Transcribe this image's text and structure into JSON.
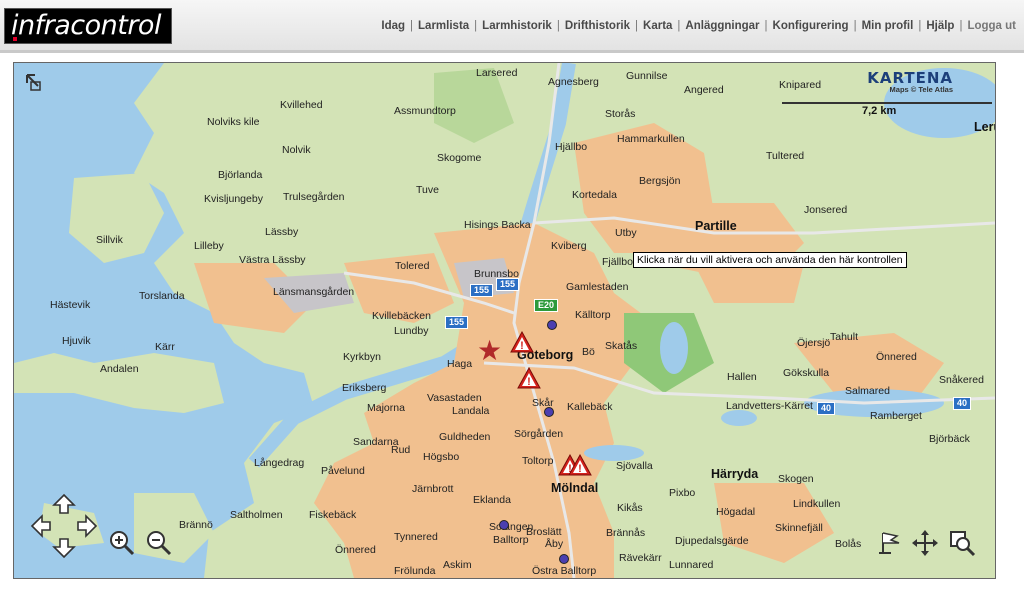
{
  "app": {
    "logo_text": "infracontrol"
  },
  "nav": {
    "items": [
      "Idag",
      "Larmlista",
      "Larmhistorik",
      "Drifthistorik",
      "Karta",
      "Anläggningar",
      "Konfigurering",
      "Min profil",
      "Hjälp"
    ],
    "logout": "Logga ut"
  },
  "map": {
    "provider": "KARTENA",
    "copyright": "Maps © Tele Atlas",
    "scale_label": "7,2 km",
    "tooltip": "Klicka när du vill aktivera och använda den här kontrollen",
    "places": [
      "Larsered",
      "Agnesberg",
      "Gunnilse",
      "Angered",
      "Knipared",
      "Kvillehed",
      "Assmundtorp",
      "Storås",
      "Nolviks kile",
      "Hjällbo",
      "Hammarkullen",
      "Tultered",
      "Lerum",
      "Nolvik",
      "Skogome",
      "Björlanda",
      "Bergsjön",
      "Kvisljungeby",
      "Trulsegården",
      "Tuve",
      "Kortedala",
      "Jonsered",
      "Partille",
      "Sillvik",
      "Lilleby",
      "Lässby",
      "Hisings Backa",
      "Kviberg",
      "Utby",
      "Västra Lässby",
      "Tolered",
      "Fjällbo",
      "Brunnsbo",
      "Gamlestaden",
      "Hästevik",
      "Torslanda",
      "Länsmansgården",
      "Kvillebäcken",
      "Lundby",
      "Källtorp",
      "Hjuvik",
      "Kärr",
      "Bö",
      "Skatås",
      "Tahult",
      "Kyrkbyn",
      "Haga",
      "Göteborg",
      "Öjersjö",
      "Önnered",
      "Andalen",
      "Hallen",
      "Gökskulla",
      "Salmared",
      "Snåkered",
      "Eriksberg",
      "Vasastaden",
      "Landala",
      "Skår",
      "Kallebäck",
      "Majorna",
      "Landvetters-Kärret",
      "Ramberget",
      "Sandarna",
      "Guldheden",
      "Sörgården",
      "Björbäck",
      "Rud",
      "Högsbo",
      "Toltorp",
      "Långedrag",
      "Påvelund",
      "Järnbrott",
      "Sjövalla",
      "Härryda",
      "Skogen",
      "Mölndal",
      "Eklanda",
      "Pixbo",
      "Lindkullen",
      "Brännö",
      "Saltholmen",
      "Fiskebäck",
      "Kikås",
      "Högadal",
      "Solängen",
      "Skinnefjäll",
      "Tynnered",
      "Broslätt",
      "Brännås",
      "Djupedalsgärde",
      "Önnered",
      "Balltorp",
      "Åby",
      "Bolås",
      "Rävekärr",
      "Lunnared",
      "Askim",
      "Östra Balltorp",
      "Frölunda"
    ],
    "roads": [
      "155",
      "155",
      "155",
      "E20",
      "40",
      "40"
    ]
  }
}
